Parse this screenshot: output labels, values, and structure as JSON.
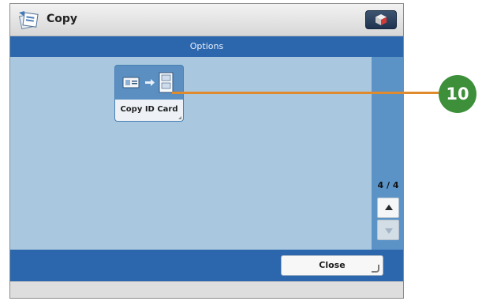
{
  "header": {
    "title": "Copy",
    "app_icon": "copy-app-icon",
    "status_icon": "status-monitor-icon"
  },
  "subheader": {
    "title": "Options"
  },
  "options": [
    {
      "label": "Copy ID Card",
      "icon": "id-card-copy-icon"
    }
  ],
  "pagination": {
    "current": 4,
    "total": 4,
    "text": "4 / 4"
  },
  "footer": {
    "close_label": "Close"
  },
  "callout": {
    "number": "10",
    "color": "#3d8f3a",
    "line_color": "#e08a2e"
  },
  "colors": {
    "accent": "#2c67ad",
    "content_bg": "#a9c8df",
    "rail": "#5b93c7"
  }
}
